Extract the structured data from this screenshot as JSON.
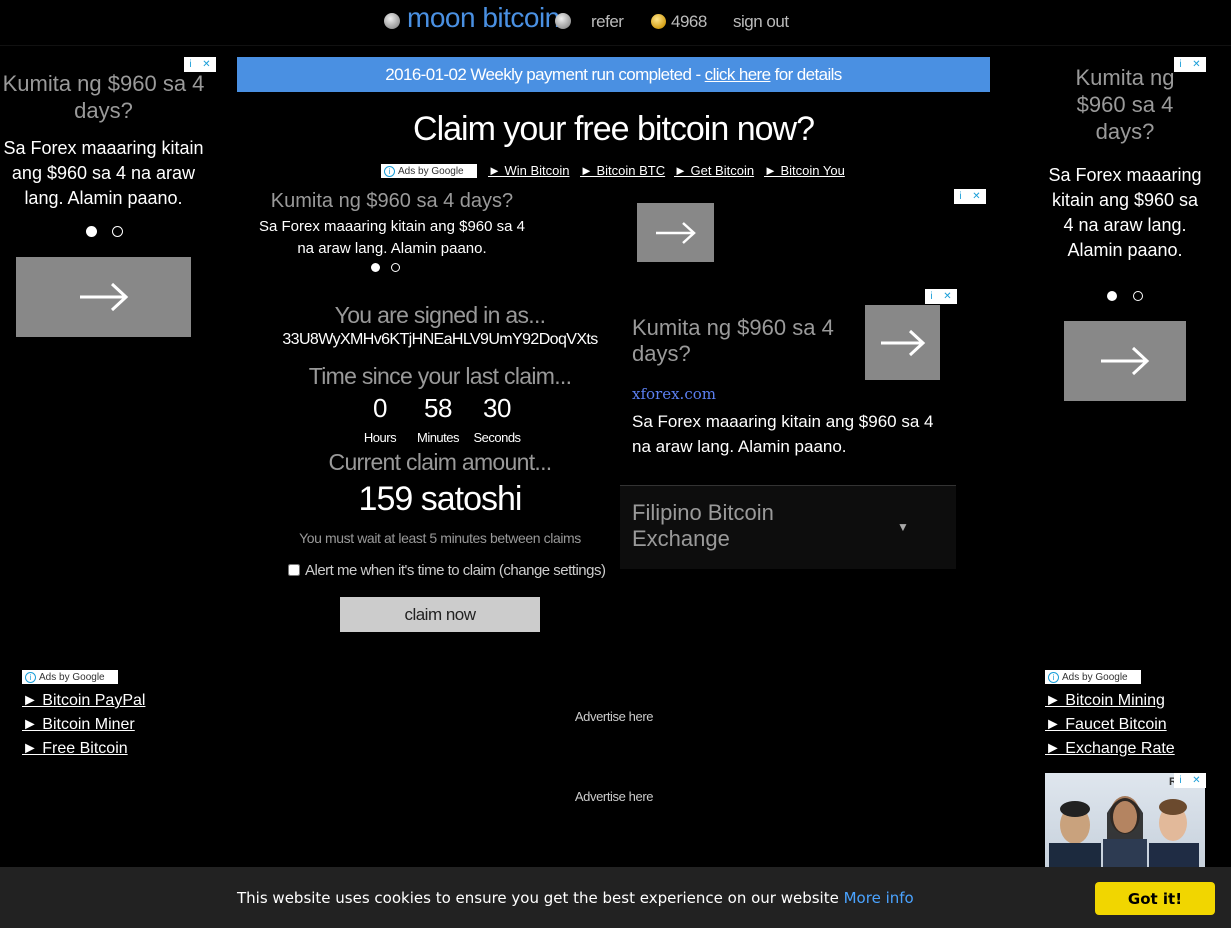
{
  "nav": {
    "brand": "moon bitcoin",
    "refer": "refer",
    "balance": "4968",
    "signout": "sign out"
  },
  "banner": {
    "prefix": "2016-01-02 Weekly payment run completed - ",
    "link": "click here",
    "suffix": " for details"
  },
  "claim_title": "Claim your free bitcoin now?",
  "adchoices": {
    "info": "i",
    "close": "✕"
  },
  "ads_by_google": "Ads by Google",
  "top_links": [
    "► Win Bitcoin",
    "► Bitcoin BTC",
    "► Get Bitcoin",
    "► Bitcoin You"
  ],
  "ad_forex": {
    "headline": "Kumita ng $960 sa 4 days?",
    "body": "Sa Forex maaaring kitain ang $960 sa 4 na araw lang. Alamin paano.",
    "domain": "xforex.com"
  },
  "right_dropdown": "Filipino Bitcoin Exchange",
  "signed_in": {
    "label": "You are signed in as...",
    "address": "33U8WyXMHv6KTjHNEaHLV9UmY92DoqVXts"
  },
  "timer": {
    "label": "Time since your last claim...",
    "hours": "0",
    "minutes": "58",
    "seconds": "30",
    "hours_label": "Hours",
    "minutes_label": "Minutes",
    "seconds_label": "Seconds"
  },
  "claim": {
    "label": "Current claim amount...",
    "amount": "159 satoshi",
    "wait_note": "You must wait at least 5 minutes between claims",
    "alert_prefix": "Alert me when it's time to claim (",
    "alert_link": "change settings",
    "alert_suffix": ")",
    "button": "claim now"
  },
  "left_links": [
    "► Bitcoin PayPal",
    "► Bitcoin Miner",
    "► Free Bitcoin"
  ],
  "right_links": [
    "► Bitcoin Mining",
    "► Faucet Bitcoin",
    "► Exchange Rate"
  ],
  "advertise": [
    "Advertise here",
    "Advertise here"
  ],
  "cookie": {
    "text": "This website uses cookies to ensure you get the best experience on our website ",
    "more": "More info",
    "button": "Got it!"
  },
  "colors": {
    "accent": "#4a90e2",
    "cookie_button": "#f1d600",
    "link_blue": "#4aa3ff"
  }
}
